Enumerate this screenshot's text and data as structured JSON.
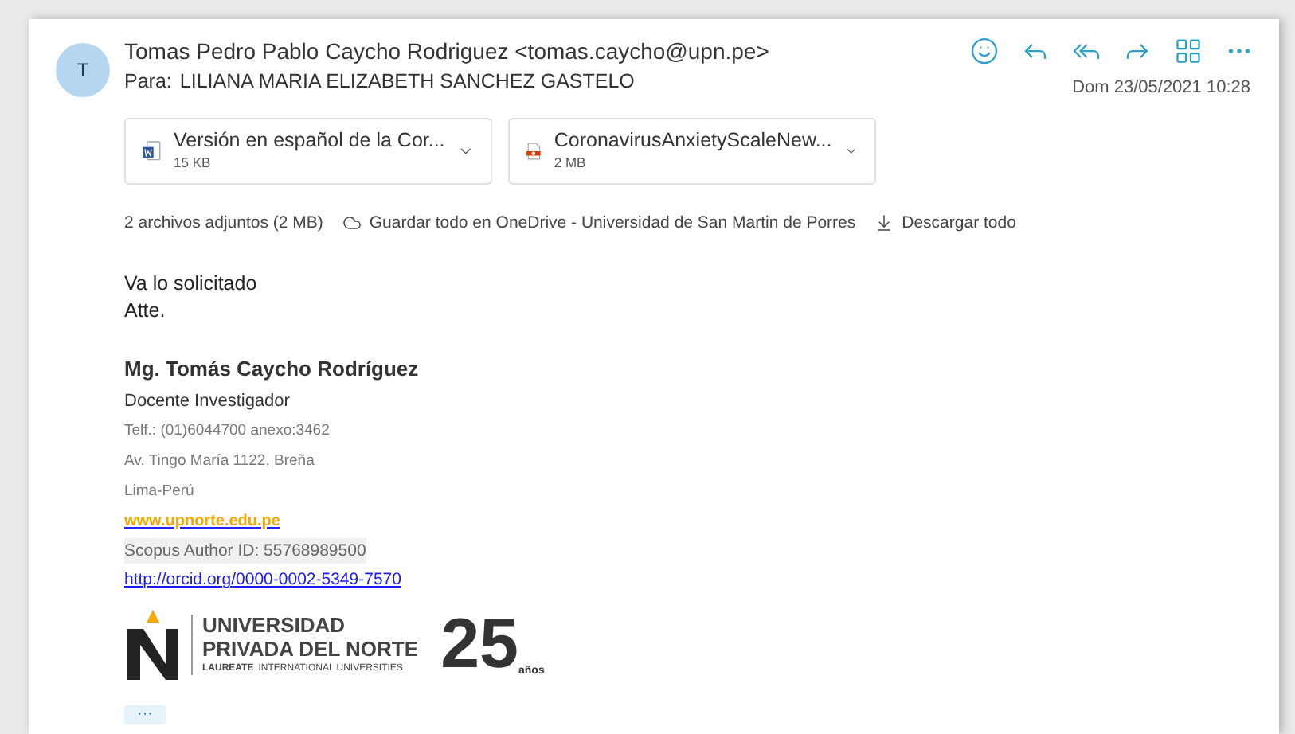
{
  "sender": {
    "initial": "T",
    "from": "Tomas Pedro Pablo Caycho Rodriguez <tomas.caycho@upn.pe>",
    "to_label": "Para:",
    "to": "LILIANA MARIA ELIZABETH SANCHEZ GASTELO",
    "date": "Dom 23/05/2021 10:28"
  },
  "attachments": [
    {
      "kind": "word",
      "name": "Versión en español de la Cor...",
      "size": "15 KB"
    },
    {
      "kind": "pdf",
      "name": "CoronavirusAnxietyScaleNew...",
      "size": "2 MB"
    }
  ],
  "attachment_bar": {
    "count": "2 archivos adjuntos (2 MB)",
    "save": "Guardar todo en OneDrive - Universidad de San Martin de Porres",
    "download": "Descargar todo"
  },
  "body": [
    "Va lo solicitado",
    "Atte."
  ],
  "signature": {
    "name": "Mg. Tomás Caycho Rodríguez",
    "role": "Docente Investigador",
    "phone": "Telf.: (01)6044700 anexo:3462",
    "address": "Av. Tingo María 1122, Breña",
    "city": "Lima-Perú",
    "website": "www.upnorte.edu.pe",
    "scopus": "Scopus Author ID: 55768989500",
    "orcid": "http://orcid.org/0000-0002-5349-7570"
  },
  "logo": {
    "line1": "UNIVERSIDAD",
    "line2": "PRIVADA DEL NORTE",
    "laureate": "LAUREATE",
    "tagline": "INTERNATIONAL UNIVERSITIES",
    "anniversary": "25",
    "anos": "años"
  },
  "more": "···"
}
